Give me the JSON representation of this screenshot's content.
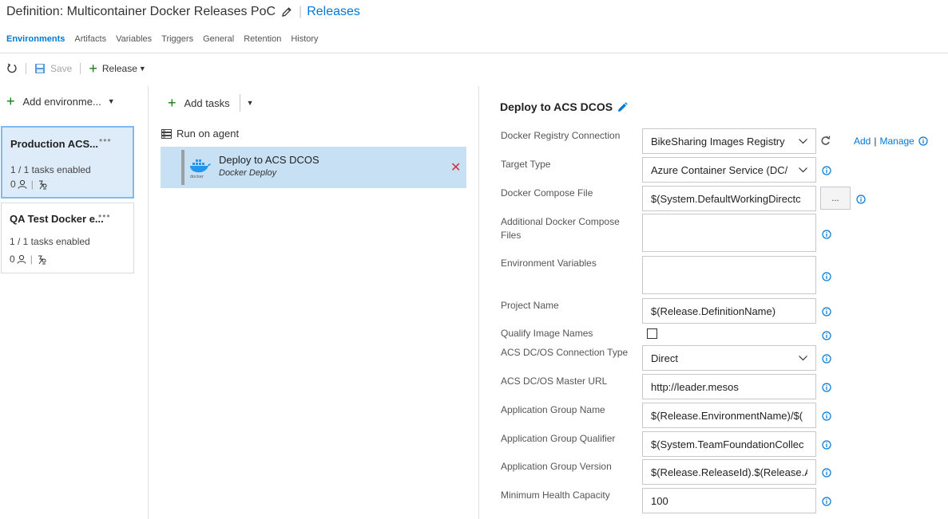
{
  "header": {
    "title": "Definition: Multicontainer Docker Releases PoC",
    "releases_link": "Releases"
  },
  "tabs": [
    "Environments",
    "Artifacts",
    "Variables",
    "Triggers",
    "General",
    "Retention",
    "History"
  ],
  "toolbar": {
    "save_label": "Save",
    "release_label": "Release"
  },
  "environments": {
    "add_label": "Add environme...",
    "items": [
      {
        "name": "Production ACS...",
        "more": "•••",
        "status": "1 / 1 tasks enabled",
        "approvers": "0"
      },
      {
        "name": "QA Test Docker e...",
        "more": "•••",
        "status": "1 / 1 tasks enabled",
        "approvers": "0"
      }
    ]
  },
  "tasks": {
    "add_label": "Add tasks",
    "run_on_agent": "Run on agent",
    "items": [
      {
        "name": "Deploy to ACS DCOS",
        "type": "Docker Deploy",
        "logo_text": "docker"
      }
    ]
  },
  "properties": {
    "title": "Deploy to ACS DCOS",
    "add_link": "Add",
    "manage_link": "Manage",
    "browse_label": "...",
    "fields": {
      "registry": {
        "label": "Docker Registry Connection",
        "value": "BikeSharing Images Registry"
      },
      "target_type": {
        "label": "Target Type",
        "value": "Azure Container Service (DC/"
      },
      "compose_file": {
        "label": "Docker Compose File",
        "value": "$(System.DefaultWorkingDirectc"
      },
      "additional_compose": {
        "label_line1": "Additional Docker Compose",
        "label_line2": "Files"
      },
      "env_vars": {
        "label": "Environment Variables"
      },
      "project_name": {
        "label": "Project Name",
        "value": "$(Release.DefinitionName)"
      },
      "qualify_images": {
        "label": "Qualify Image Names",
        "checked": false
      },
      "conn_type": {
        "label": "ACS DC/OS Connection Type",
        "value": "Direct"
      },
      "master_url": {
        "label": "ACS DC/OS Master URL",
        "value": "http://leader.mesos"
      },
      "group_name": {
        "label": "Application Group Name",
        "value": "$(Release.EnvironmentName)/$("
      },
      "group_qualifier": {
        "label": "Application Group Qualifier",
        "value": "$(System.TeamFoundationCollec"
      },
      "group_version": {
        "label": "Application Group Version",
        "value": "$(Release.ReleaseId).$(Release.A"
      },
      "min_health": {
        "label": "Minimum Health Capacity",
        "value": "100"
      }
    }
  },
  "colors": {
    "accent": "#0078d7",
    "add_green": "#107c10",
    "selected_card_bg": "#deecf9",
    "selected_task_bg": "#c7e0f4",
    "remove_red": "#d13438"
  },
  "icons": [
    "pencil-icon",
    "refresh-icon",
    "save-icon",
    "plus-icon",
    "chevron-down-icon",
    "user-icon",
    "deploy-icon",
    "server-icon",
    "docker-icon",
    "close-icon",
    "info-icon"
  ]
}
